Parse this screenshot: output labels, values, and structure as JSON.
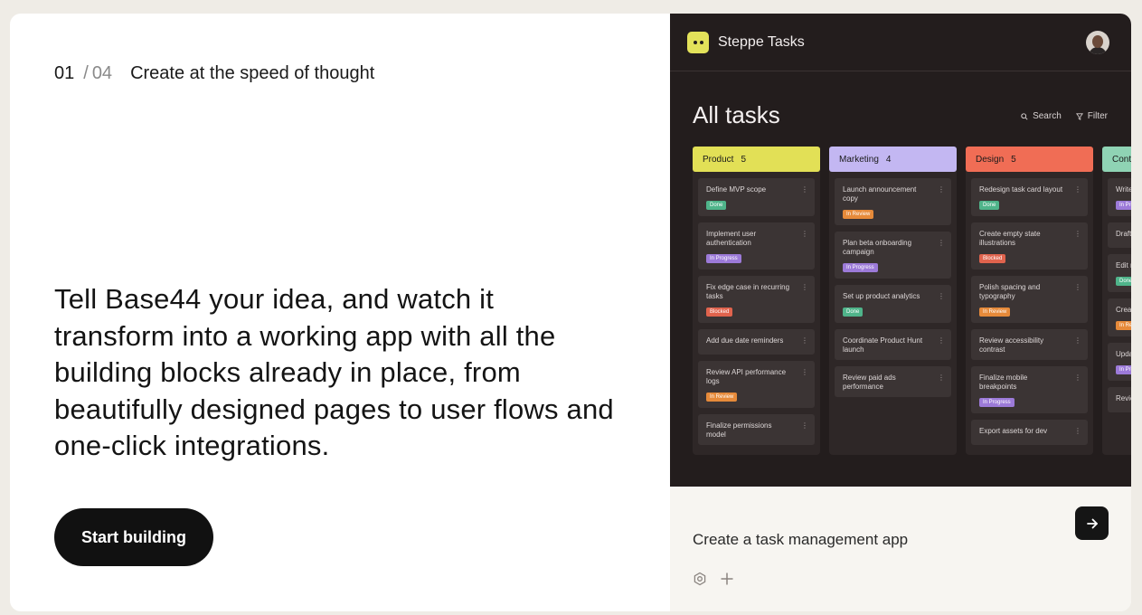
{
  "step": {
    "current": "01",
    "separator": "/",
    "total": "04",
    "title": "Create at the speed of thought"
  },
  "headline": "Tell Base44 your idea, and watch it transform into a working app with all the building blocks already in place, from beautifully designed pages to user flows and one-click integrations.",
  "cta": {
    "label": "Start building"
  },
  "preview": {
    "app_name": "Steppe Tasks",
    "board_title": "All tasks",
    "search_label": "Search",
    "filter_label": "Filter",
    "columns": [
      {
        "name": "Product",
        "count": "5",
        "color": "#e2e056",
        "tasks": [
          {
            "title": "Define MVP scope",
            "badge": "Done",
            "badge_color": "#4fb48a"
          },
          {
            "title": "Implement user authentication",
            "badge": "In Progress",
            "badge_color": "#9c7ad8"
          },
          {
            "title": "Fix edge case in recurring tasks",
            "badge": "Blocked",
            "badge_color": "#e0634d"
          },
          {
            "title": "Add due date reminders",
            "badge": "",
            "badge_color": ""
          },
          {
            "title": "Review API performance logs",
            "badge": "In Review",
            "badge_color": "#e68a3a"
          },
          {
            "title": "Finalize permissions model",
            "badge": "",
            "badge_color": ""
          }
        ]
      },
      {
        "name": "Marketing",
        "count": "4",
        "color": "#c3b7f2",
        "tasks": [
          {
            "title": "Launch announcement copy",
            "badge": "In Review",
            "badge_color": "#e68a3a"
          },
          {
            "title": "Plan beta onboarding campaign",
            "badge": "In Progress",
            "badge_color": "#9c7ad8"
          },
          {
            "title": "Set up product analytics",
            "badge": "Done",
            "badge_color": "#4fb48a"
          },
          {
            "title": "Coordinate Product Hunt launch",
            "badge": "",
            "badge_color": ""
          },
          {
            "title": "Review paid ads performance",
            "badge": "",
            "badge_color": ""
          }
        ]
      },
      {
        "name": "Design",
        "count": "5",
        "color": "#f06d55",
        "tasks": [
          {
            "title": "Redesign task card layout",
            "badge": "Done",
            "badge_color": "#4fb48a"
          },
          {
            "title": "Create empty state illustrations",
            "badge": "Blocked",
            "badge_color": "#e0634d"
          },
          {
            "title": "Polish spacing and typography",
            "badge": "In Review",
            "badge_color": "#e68a3a"
          },
          {
            "title": "Review accessibility contrast",
            "badge": "",
            "badge_color": ""
          },
          {
            "title": "Finalize mobile breakpoints",
            "badge": "In Progress",
            "badge_color": "#9c7ad8"
          },
          {
            "title": "Export assets for dev",
            "badge": "",
            "badge_color": ""
          }
        ]
      },
      {
        "name": "Conte",
        "count": "",
        "color": "#8fd3b4",
        "tasks": [
          {
            "title": "Write",
            "badge": "In Pro",
            "badge_color": "#9c7ad8"
          },
          {
            "title": "Draft",
            "badge": "",
            "badge_color": ""
          },
          {
            "title": "Edit re",
            "badge": "Done",
            "badge_color": "#4fb48a"
          },
          {
            "title": "Creat seque",
            "badge": "In Re",
            "badge_color": "#e68a3a"
          },
          {
            "title": "Upda",
            "badge": "In Pro",
            "badge_color": "#9c7ad8"
          },
          {
            "title": "Revie",
            "badge": "",
            "badge_color": ""
          }
        ]
      }
    ]
  },
  "prompt": {
    "text": "Create a task management app"
  },
  "icons": {
    "send": "arrow-right-icon",
    "settings": "gear-icon",
    "add": "plus-icon",
    "search": "search-icon",
    "filter": "filter-icon"
  }
}
